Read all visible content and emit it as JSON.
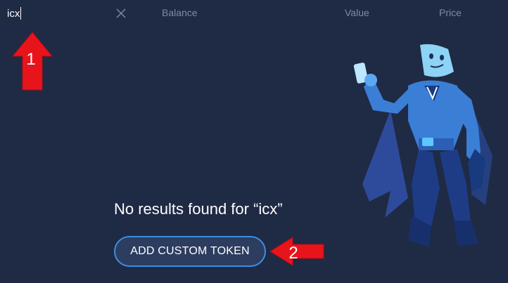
{
  "search": {
    "value": "icx"
  },
  "columns": {
    "balance": "Balance",
    "value": "Value",
    "price": "Price"
  },
  "empty_state": {
    "message": "No results found for “icx”"
  },
  "actions": {
    "add_custom_token": "ADD CUSTOM TOKEN"
  },
  "annotations": {
    "step1": "1",
    "step2": "2"
  },
  "colors": {
    "background": "#1f2a44",
    "accent": "#3b8fe0",
    "annotation_red": "#e8141c"
  },
  "icons": {
    "clear": "close-icon",
    "mascot": "superhero-mascot-illustration"
  }
}
